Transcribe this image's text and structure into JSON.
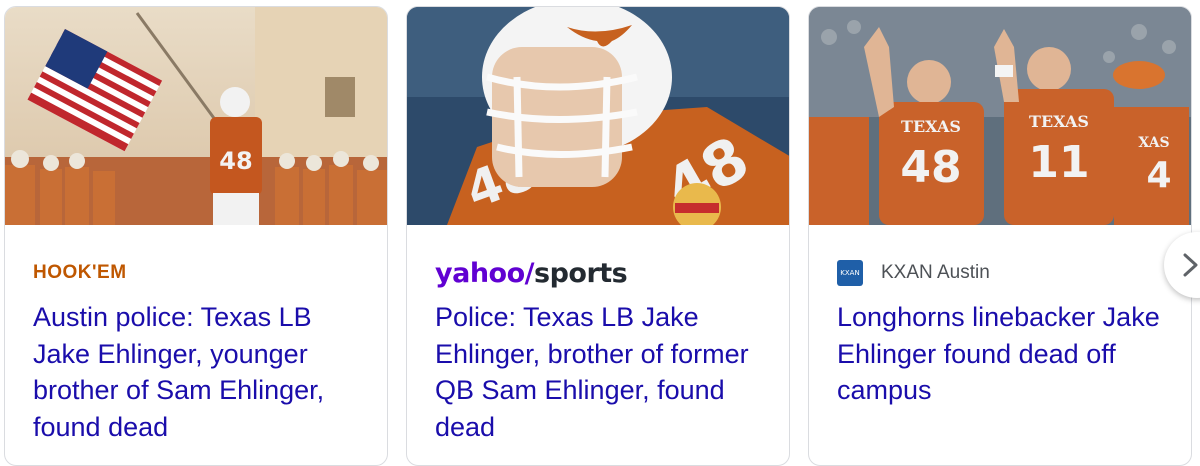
{
  "cards": [
    {
      "image_alt": "Texas Longhorns player #48 carrying an American flag onto the field",
      "source": {
        "name": "HOOK'EM",
        "suffix": ""
      },
      "headline": "Austin police: Texas LB Jake Ehlinger, younger brother of Sam Ehlinger, found dead"
    },
    {
      "image_alt": "Close-up of Texas player #48 in white helmet with Valero Alamo Bowl patch",
      "source": {
        "name_part1": "yahoo",
        "name_part2": "sports"
      },
      "headline": "Police: Texas LB Jake Ehlinger, brother of former QB Sam Ehlinger, found dead"
    },
    {
      "image_alt": "Texas players #48 and #11 celebrating with hook 'em horns",
      "source": {
        "logo_text": "KXAN",
        "name": "KXAN Austin"
      },
      "headline": "Longhorns linebacker Jake Ehlinger found dead off campus"
    }
  ],
  "colors": {
    "headline": "#1a0dab",
    "burnt_orange": "#bf5700",
    "yahoo_purple": "#6001d2",
    "border": "#dadce0"
  },
  "icons": {
    "next": "chevron-right-icon"
  }
}
